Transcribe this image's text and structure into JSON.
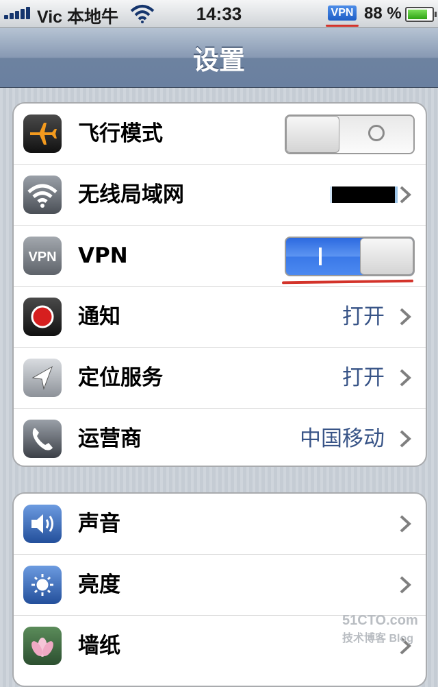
{
  "status_bar": {
    "carrier": "Vic 本地牛",
    "time": "14:33",
    "vpn_badge": "VPN",
    "battery_percent": "88 %",
    "battery_level": 0.88
  },
  "nav": {
    "title": "设置"
  },
  "group1": [
    {
      "label": "飞行模式",
      "icon": "airplane-icon",
      "control": "switch",
      "state": "off"
    },
    {
      "label": "无线局域网",
      "icon": "wifi-icon",
      "value": "",
      "chevron": true
    },
    {
      "label": "VPN",
      "icon": "vpn-icon",
      "control": "switch",
      "state": "on"
    },
    {
      "label": "通知",
      "icon": "notification-icon",
      "value": "打开",
      "chevron": true
    },
    {
      "label": "定位服务",
      "icon": "location-icon",
      "value": "打开",
      "chevron": true
    },
    {
      "label": "运营商",
      "icon": "phone-icon",
      "value": "中国移动",
      "chevron": true
    }
  ],
  "group2": [
    {
      "label": "声音",
      "icon": "sound-icon",
      "chevron": true
    },
    {
      "label": "亮度",
      "icon": "brightness-icon",
      "chevron": true
    },
    {
      "label": "墙纸",
      "icon": "wallpaper-icon",
      "chevron": true
    }
  ],
  "watermark": {
    "line1": "51CTO.com",
    "line2": "技术博客 Blog"
  },
  "colors": {
    "accent": "#385487",
    "switch_on": "#3a79e8",
    "annotation": "#d3332a"
  }
}
